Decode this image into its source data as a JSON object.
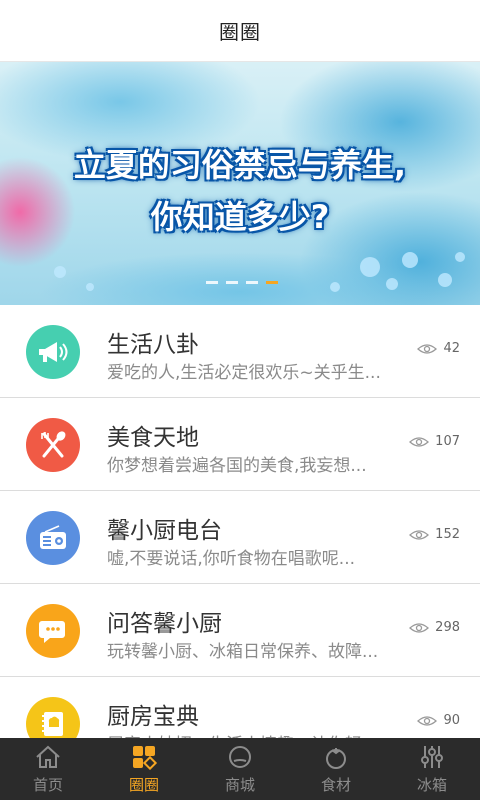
{
  "header": {
    "title": "圈圈"
  },
  "banner": {
    "line1": "立夏的习俗禁忌与养生,",
    "line2": "你知道多少?",
    "slide_count": 4,
    "active_slide": 4
  },
  "list": {
    "items": [
      {
        "title": "生活八卦",
        "desc": "爱吃的人,生活必定很欢乐~关乎生...",
        "views": "42",
        "icon": "megaphone-icon",
        "color": "#46cfb0"
      },
      {
        "title": "美食天地",
        "desc": "你梦想着尝遍各国的美食,我妄想...",
        "views": "107",
        "icon": "fork-spoon-icon",
        "color": "#f05a45"
      },
      {
        "title": "馨小厨电台",
        "desc": "嘘,不要说话,你听食物在唱歌呢...",
        "views": "152",
        "icon": "radio-icon",
        "color": "#5a8fe0"
      },
      {
        "title": "问答馨小厨",
        "desc": "玩转馨小厨、冰箱日常保养、故障...",
        "views": "298",
        "icon": "chat-icon",
        "color": "#f9a51a"
      },
      {
        "title": "厨房宝典",
        "desc": "居家小妙招、生活小情趣、让你轻...",
        "views": "90",
        "icon": "cookbook-icon",
        "color": "#f5c518"
      }
    ]
  },
  "nav": {
    "items": [
      {
        "label": "首页",
        "icon": "home-icon",
        "active": false
      },
      {
        "label": "圈圈",
        "icon": "grid-icon",
        "active": true
      },
      {
        "label": "商城",
        "icon": "mall-icon",
        "active": false
      },
      {
        "label": "食材",
        "icon": "tomato-icon",
        "active": false
      },
      {
        "label": "冰箱",
        "icon": "sliders-icon",
        "active": false
      }
    ],
    "active_color": "#f5a623",
    "inactive_color": "#8c8c8c"
  }
}
